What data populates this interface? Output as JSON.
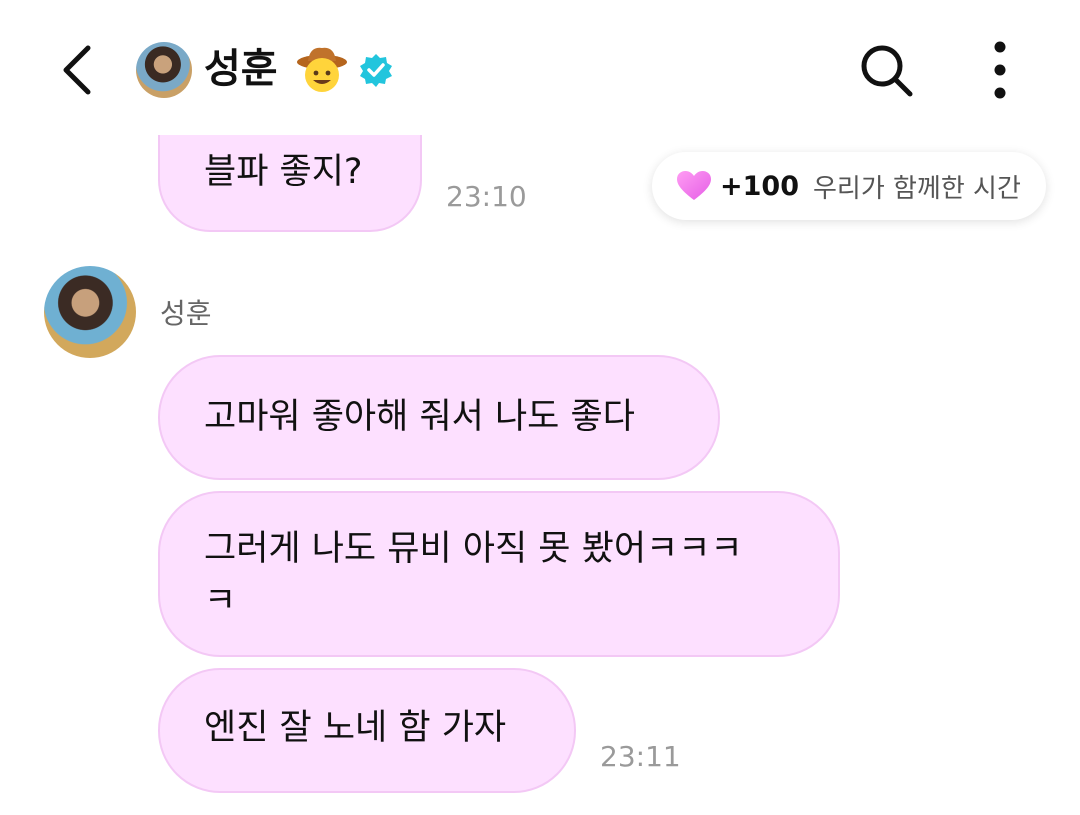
{
  "header": {
    "name": "성훈",
    "emoji_icon": "cowboy-face-emoji"
  },
  "messages": [
    {
      "text": "블파 좋지?",
      "time": "23:10"
    },
    {
      "sender": "성훈",
      "text": "고마워 좋아해 줘서 나도 좋다"
    },
    {
      "text": "그러게 나도 뮤비 아직 못 봤어ㅋㅋㅋ\nㅋ"
    },
    {
      "text": "엔진 잘 노네 함 가자",
      "time": "23:11"
    }
  ],
  "toast": {
    "value": "+100",
    "label": "우리가 함께한 시간"
  },
  "colors": {
    "bubble": "#fde0ff",
    "bubble_border": "#f3c8f5",
    "verified": "#22c5dd",
    "heart": "#f07cf0"
  }
}
